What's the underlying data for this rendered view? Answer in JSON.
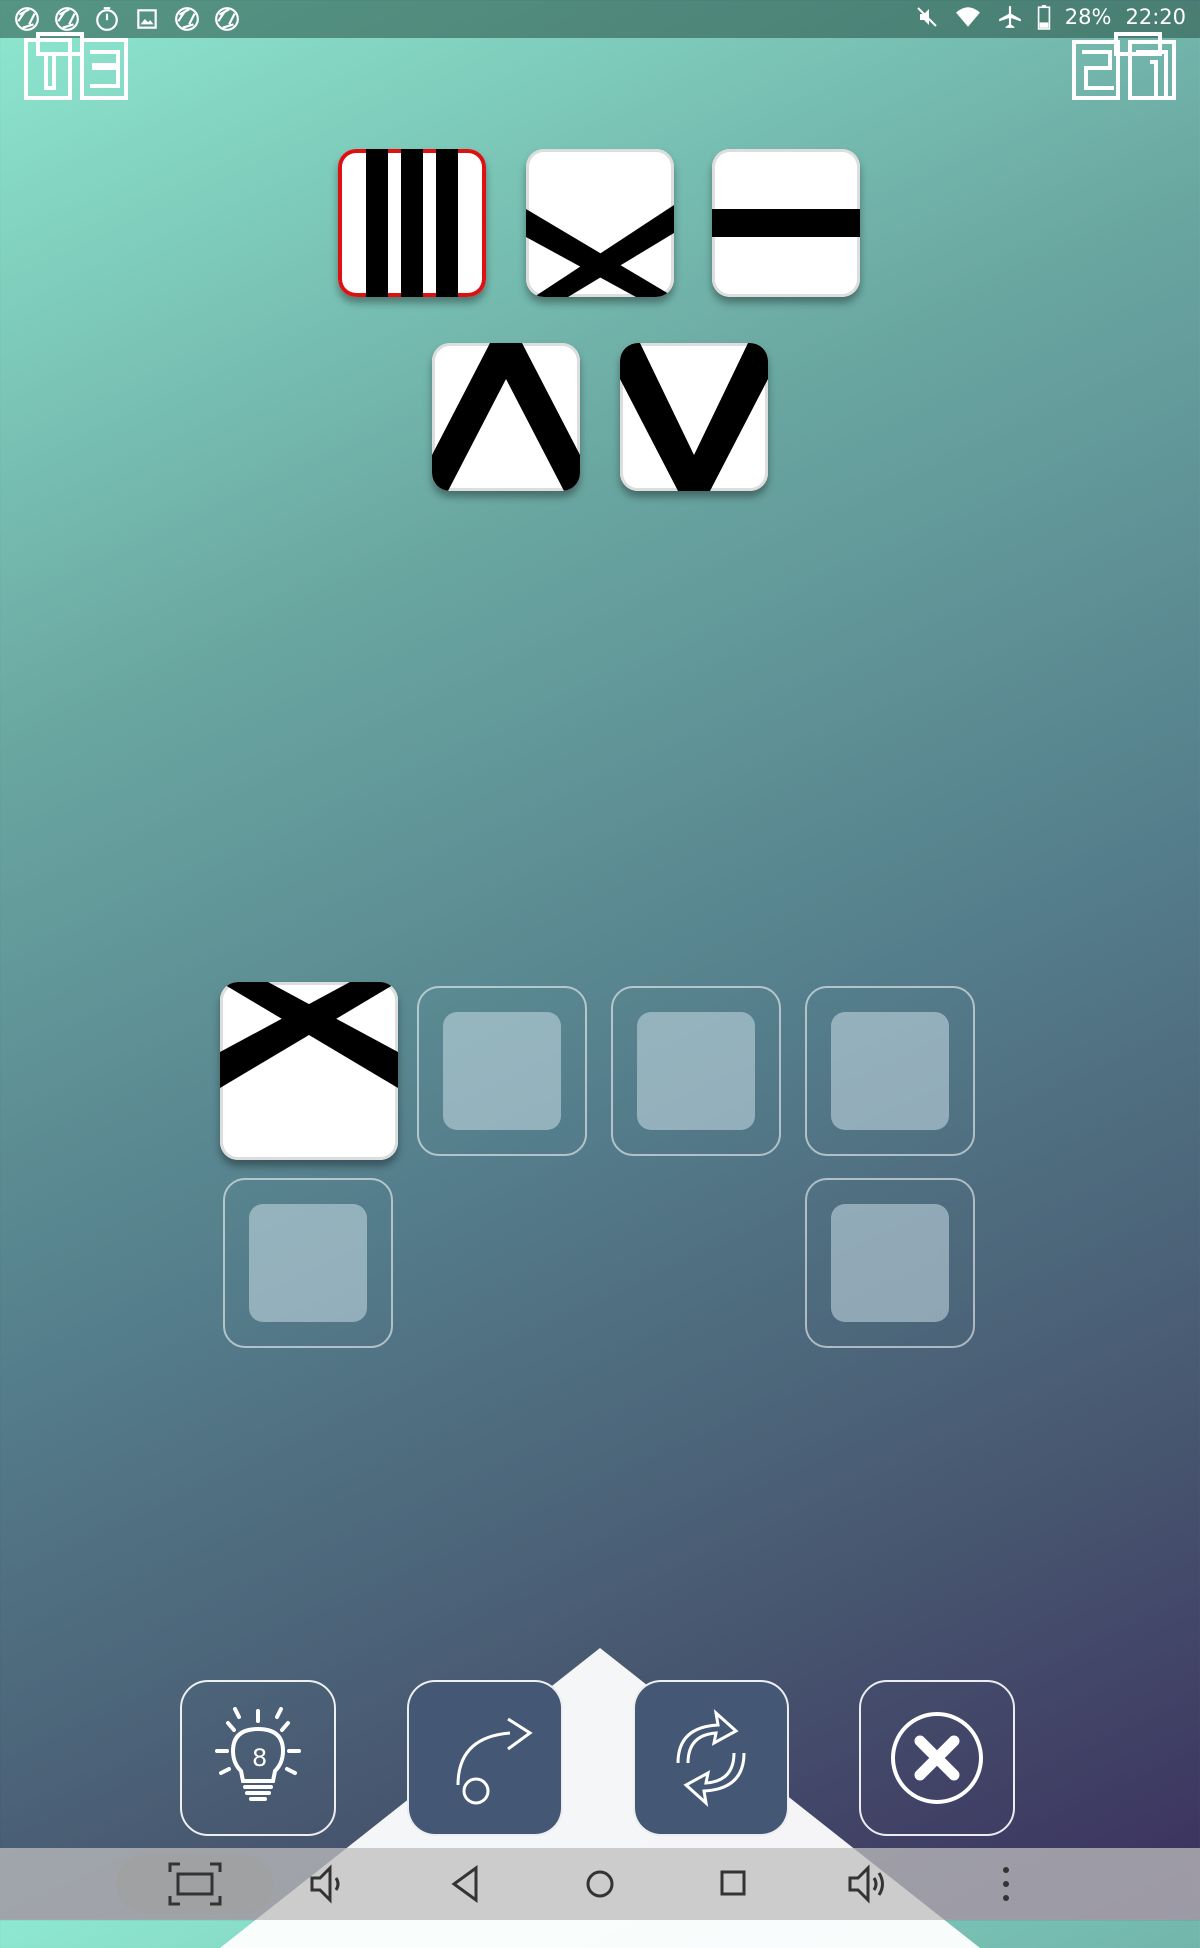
{
  "status_bar": {
    "battery": "28%",
    "time": "22:20",
    "left_icons": [
      "aperture-icon",
      "aperture-icon",
      "timer-icon",
      "image-icon",
      "aperture-icon",
      "aperture-icon"
    ],
    "right_icons": [
      "mute-icon",
      "wifi-icon",
      "airplane-icon",
      "battery-icon"
    ]
  },
  "header": {
    "left_counter": "03",
    "right_counter": "27"
  },
  "puzzle": {
    "tiles": [
      {
        "pattern": "vertical-stripes",
        "selected": true
      },
      {
        "pattern": "cross-bottom",
        "selected": false
      },
      {
        "pattern": "horizontal-bar",
        "selected": false
      },
      {
        "pattern": "caret-up",
        "selected": false
      },
      {
        "pattern": "caret-down",
        "selected": false
      }
    ],
    "slots": [
      {
        "filled": true,
        "pattern": "cross-top"
      },
      {
        "filled": false
      },
      {
        "filled": false
      },
      {
        "filled": false
      },
      {
        "filled": false
      },
      {
        "filled": false
      }
    ]
  },
  "controls": {
    "hint_count": "8",
    "buttons": [
      "hint-button",
      "redo-button",
      "restart-button",
      "close-button"
    ]
  },
  "nav_bar": {
    "buttons": [
      "screenshot-button",
      "volume-down-button",
      "back-button",
      "home-button",
      "recents-button",
      "volume-up-button",
      "more-button"
    ]
  },
  "colors": {
    "accent_selected": "#d11111",
    "button_fill": "#445774"
  }
}
